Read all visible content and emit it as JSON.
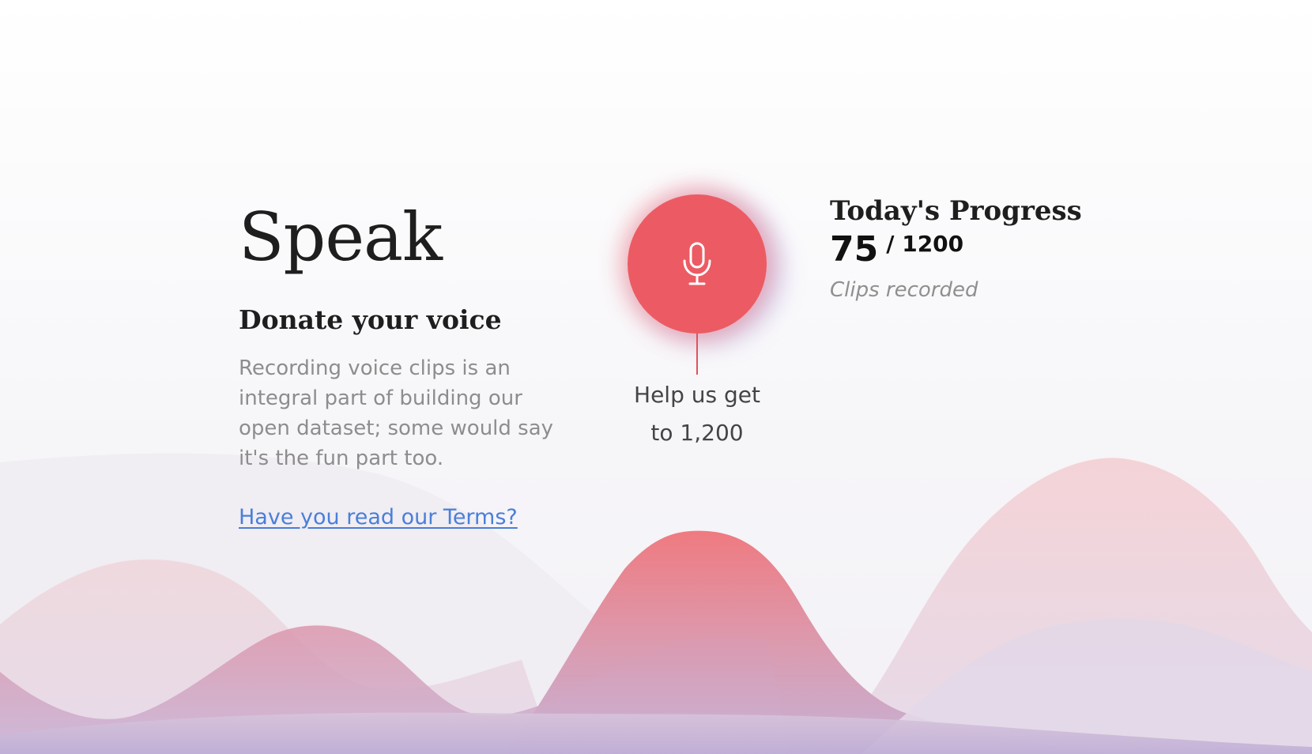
{
  "hero": {
    "title": "Speak",
    "subtitle": "Donate your voice",
    "description": "Recording voice clips is an integral part of building our open dataset; some would say it's the fun part too.",
    "terms_link": "Have you read our Terms?"
  },
  "record": {
    "icon": "microphone-icon",
    "help_text_line1": "Help us get",
    "help_text_line2": "to 1,200"
  },
  "progress": {
    "title": "Today's Progress",
    "current": "75",
    "total": "/ 1200",
    "label": "Clips recorded",
    "value": 75,
    "goal": 1200
  },
  "colors": {
    "accent": "#ec5b63",
    "link": "#4a7fd9",
    "muted_text": "#8d8d8d"
  }
}
